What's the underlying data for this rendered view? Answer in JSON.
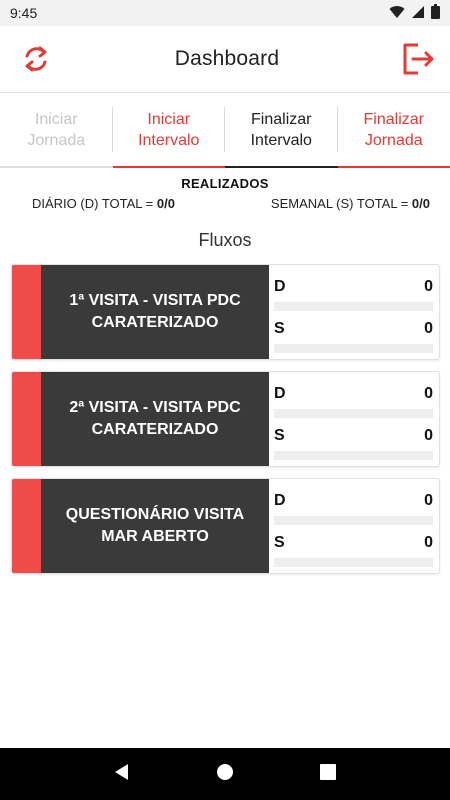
{
  "status_bar": {
    "time": "9:45"
  },
  "app_bar": {
    "title": "Dashboard",
    "refresh_icon": "sync-icon",
    "logout_icon": "exit-icon"
  },
  "colors": {
    "accent": "#e53935",
    "card_dark": "#3a3a3a",
    "card_accent": "#ef4b48"
  },
  "tabs": [
    {
      "line1": "Iniciar",
      "line2": "Jornada",
      "state": "disabled"
    },
    {
      "line1": "Iniciar",
      "line2": "Intervalo",
      "state": "active"
    },
    {
      "line1": "Finalizar",
      "line2": "Intervalo",
      "state": "default"
    },
    {
      "line1": "Finalizar",
      "line2": "Jornada",
      "state": "active"
    }
  ],
  "summary": {
    "title": "REALIZADOS",
    "daily_label": "DIÁRIO (D) TOTAL = ",
    "daily_value": "0/0",
    "weekly_label": "SEMANAL (S) TOTAL = ",
    "weekly_value": "0/0"
  },
  "flows_title": "Fluxos",
  "flows": [
    {
      "name": "1ª VISITA - VISITA PDC CARATERIZADO",
      "d_label": "D",
      "d_value": "0",
      "d_progress": 0,
      "s_label": "S",
      "s_value": "0",
      "s_progress": 0
    },
    {
      "name": "2ª VISITA - VISITA PDC CARATERIZADO",
      "d_label": "D",
      "d_value": "0",
      "d_progress": 0,
      "s_label": "S",
      "s_value": "0",
      "s_progress": 0
    },
    {
      "name": "QUESTIONÁRIO VISITA MAR ABERTO",
      "d_label": "D",
      "d_value": "0",
      "d_progress": 0,
      "s_label": "S",
      "s_value": "0",
      "s_progress": 0
    }
  ]
}
